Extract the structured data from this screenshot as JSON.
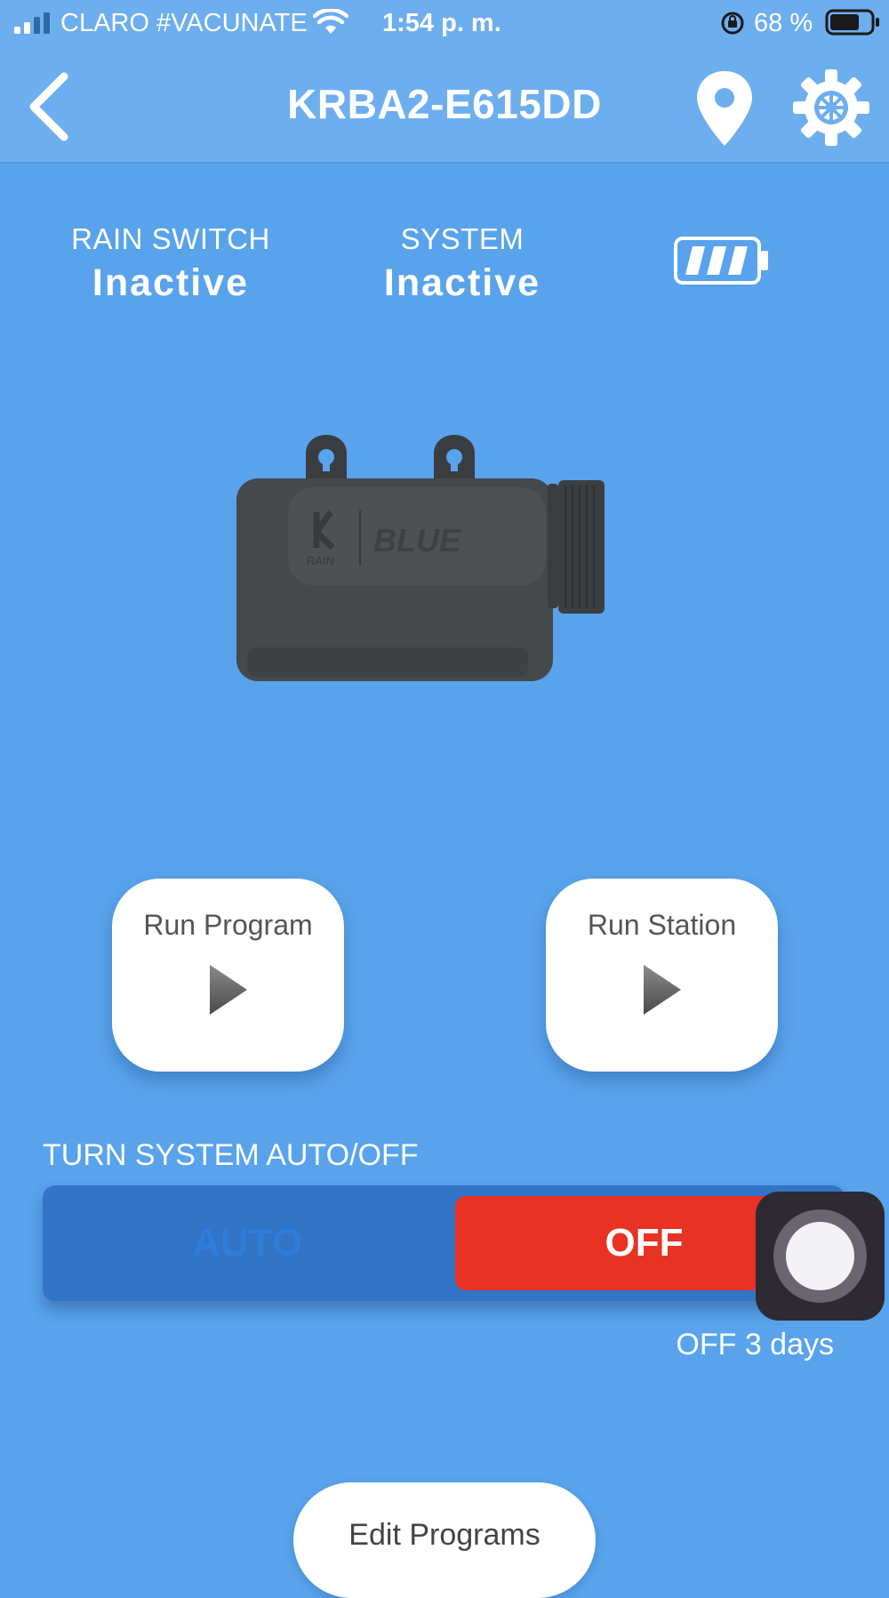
{
  "status_bar": {
    "carrier": "CLARO #VACUNATE",
    "time": "1:54 p. m.",
    "battery_percent": "68 %"
  },
  "header": {
    "title": "KRBA2-E615DD",
    "icons": [
      "back-chevron-icon",
      "location-pin-icon",
      "gear-icon"
    ]
  },
  "status": {
    "rain_switch": {
      "label": "RAIN SWITCH",
      "value": "Inactive"
    },
    "system": {
      "label": "SYSTEM",
      "value": "Inactive"
    },
    "battery_level": 0.75
  },
  "device_image": {
    "brand_text": "BLUE",
    "logo_text": "RAIN"
  },
  "actions": {
    "run_program": "Run Program",
    "run_station": "Run Station"
  },
  "system_toggle": {
    "label": "TURN SYSTEM AUTO/OFF",
    "auto_label": "AUTO",
    "off_label": "OFF",
    "selected": "OFF",
    "off_note": "OFF 3 days"
  },
  "edit_programs": "Edit Programs",
  "colors": {
    "background": "#58a3ec",
    "header": "#6daeef",
    "toggle_track": "#3274c5",
    "off_active": "#e83223"
  }
}
